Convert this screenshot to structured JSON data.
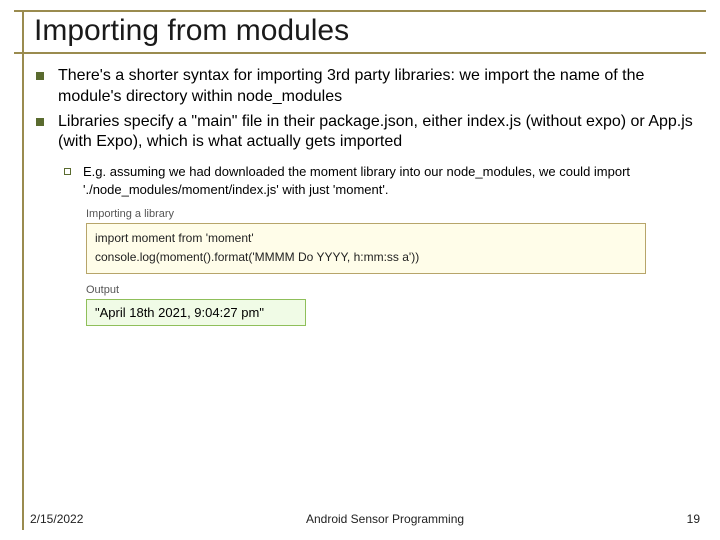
{
  "title": "Importing from modules",
  "bullets": [
    "There's a shorter syntax for importing 3rd party libraries: we import the name of the module's directory within node_modules",
    "Libraries specify a \"main\" file in their package.json, either index.js (without expo) or App.js (with Expo), which is what actually gets imported"
  ],
  "sub": "E.g. assuming we had downloaded the moment library into our node_modules, we could import './node_modules/moment/index.js' with just 'moment'.",
  "code_label": "Importing a library",
  "code_lines": [
    "import moment from 'moment'",
    "console.log(moment().format('MMMM Do YYYY, h:mm:ss a'))"
  ],
  "output_label": "Output",
  "output_text": "\"April 18th 2021, 9:04:27 pm\"",
  "footer": {
    "date": "2/15/2022",
    "center": "Android Sensor Programming",
    "page": "19"
  }
}
